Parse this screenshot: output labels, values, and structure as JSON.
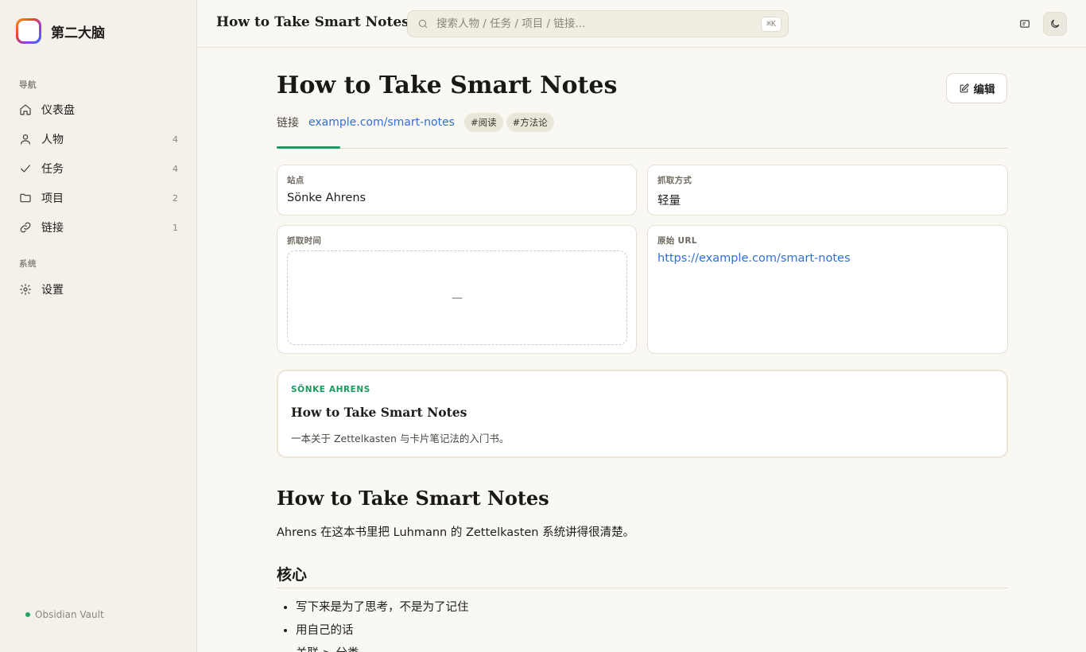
{
  "app": {
    "name": "第二大脑",
    "vault": "Obsidian Vault"
  },
  "sidebar": {
    "nav_section": "导航",
    "system_section": "系统",
    "items": [
      {
        "label": "仪表盘",
        "icon": "home-icon",
        "count": ""
      },
      {
        "label": "人物",
        "icon": "user-icon",
        "count": "4"
      },
      {
        "label": "任务",
        "icon": "check-icon",
        "count": "4"
      },
      {
        "label": "项目",
        "icon": "folder-icon",
        "count": "2"
      },
      {
        "label": "链接",
        "icon": "link-icon",
        "count": "1"
      }
    ],
    "settings": {
      "label": "设置",
      "icon": "gear-icon"
    }
  },
  "topbar": {
    "title": "How to Take Smart Notes",
    "search_placeholder": "搜索人物 / 任务 / 项目 / 链接...",
    "search_value": "",
    "shortcut": "⌘K"
  },
  "page": {
    "title": "How to Take Smart Notes",
    "edit_label": "编辑",
    "type_label": "链接",
    "link_text": "example.com/smart-notes",
    "tags": [
      "#阅读",
      "#方法论"
    ]
  },
  "fields": {
    "site": {
      "label": "站点",
      "value": "Sönke Ahrens"
    },
    "capture_method": {
      "label": "抓取方式",
      "value": "轻量"
    },
    "capture_time": {
      "label": "抓取时间",
      "value": "—"
    },
    "original_url": {
      "label": "原始 URL",
      "value": "https://example.com/smart-notes"
    }
  },
  "preview": {
    "kicker": "SÖNKE AHRENS",
    "title": "How to Take Smart Notes",
    "description": "一本关于 Zettelkasten 与卡片笔记法的入门书。"
  },
  "content": {
    "heading": "How to Take Smart Notes",
    "paragraph": "Ahrens 在这本书里把 Luhmann 的 Zettelkasten 系统讲得很清楚。",
    "subheading": "核心",
    "bullets": [
      "写下来是为了思考，不是为了记住",
      "用自己的话",
      "关联 > 分类"
    ]
  },
  "colors": {
    "accent": "#1c9a62",
    "link": "#2f6fd6",
    "background": "#faf8f3",
    "sidebar": "#f4f1ea"
  }
}
